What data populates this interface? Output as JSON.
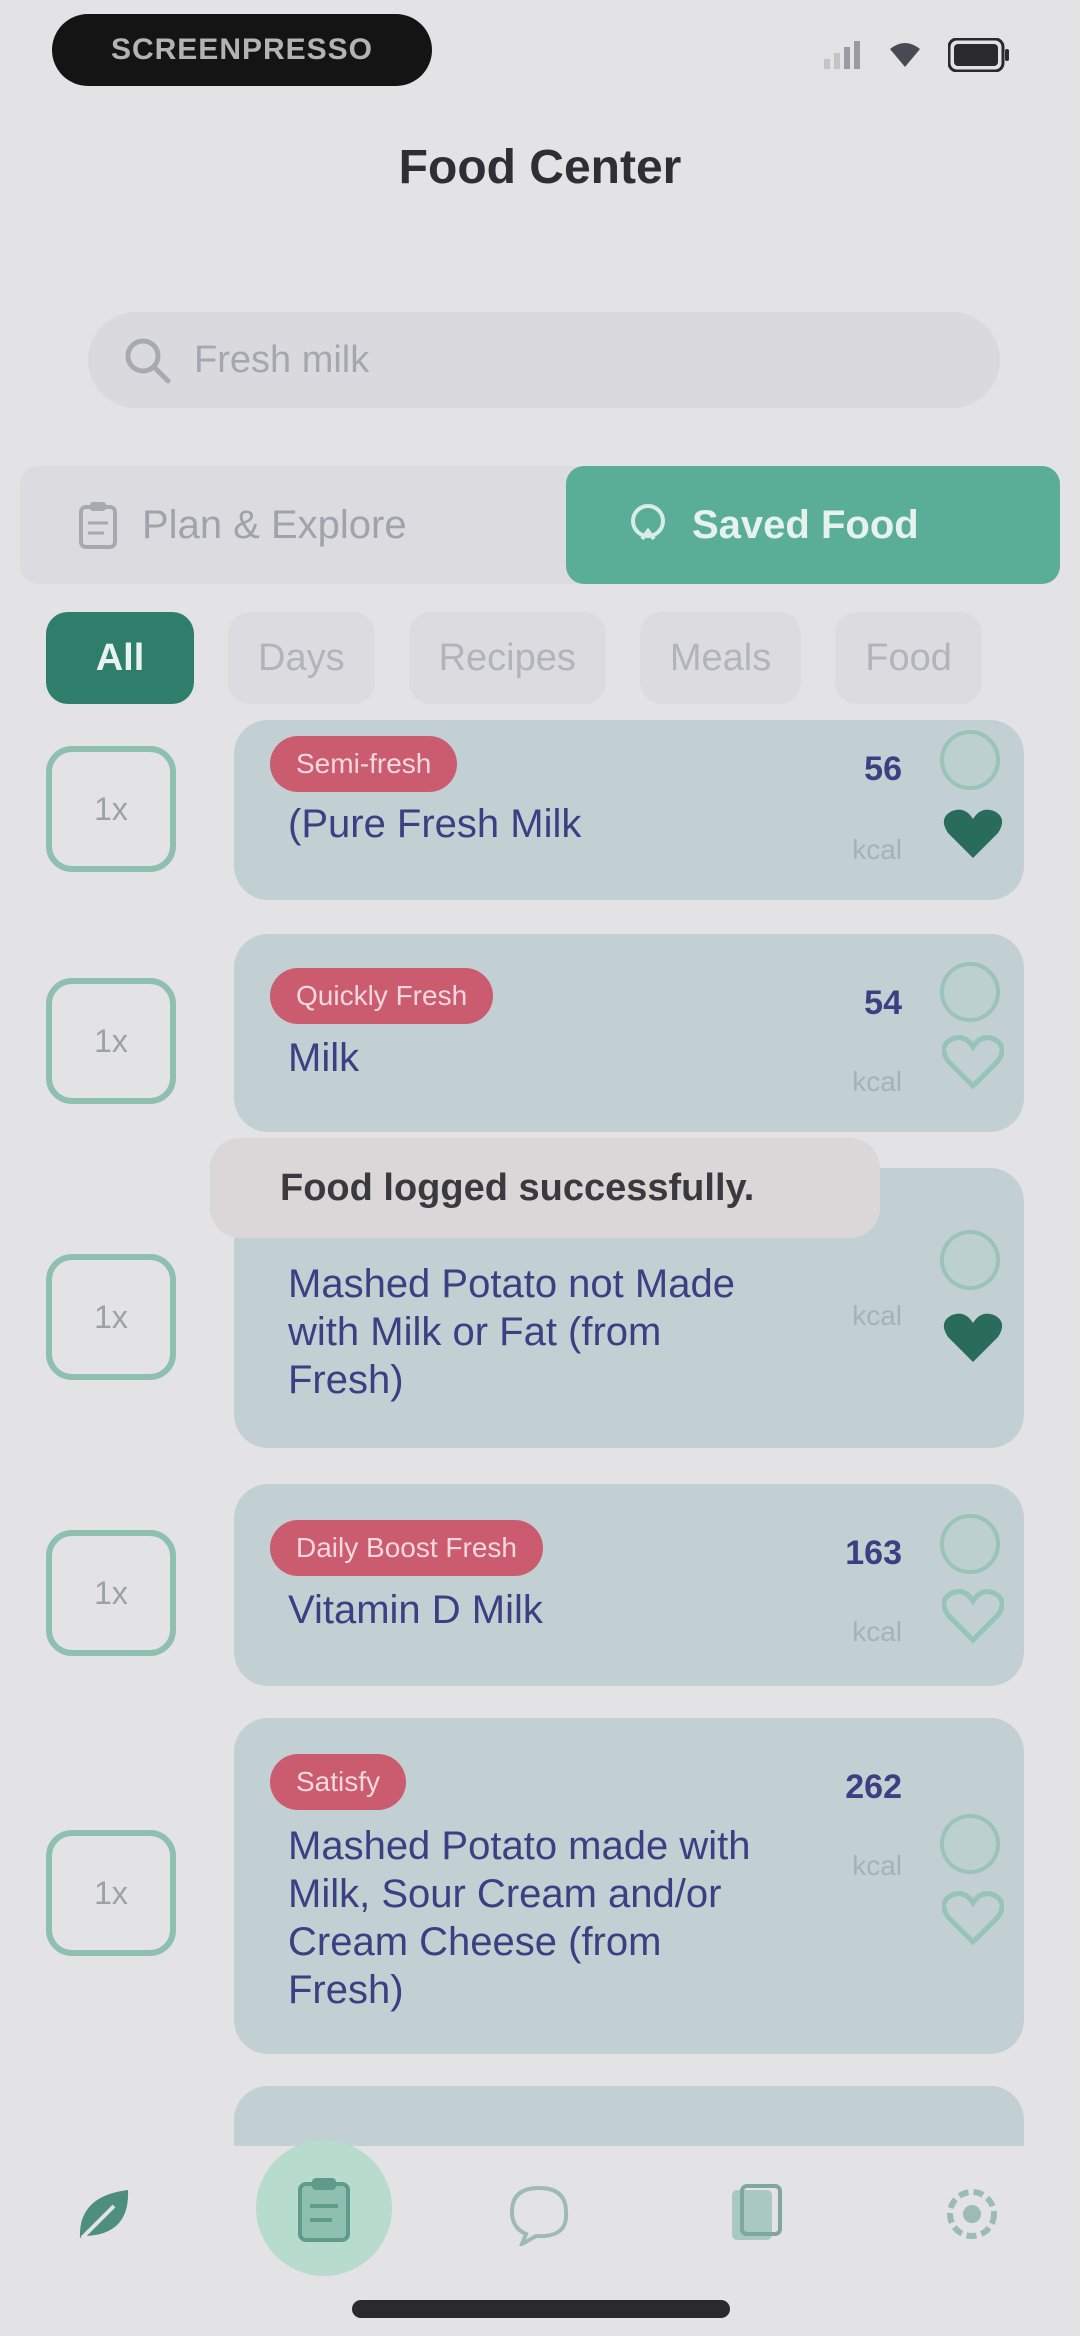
{
  "status_bar": {
    "pill_text": "SCREENPRESSO"
  },
  "header": {
    "title": "Food Center"
  },
  "search": {
    "placeholder": "Fresh milk"
  },
  "segments": [
    {
      "label": "Plan & Explore",
      "icon": "clipboard-icon",
      "active": false
    },
    {
      "label": "Saved Food",
      "icon": "bookmark-icon",
      "active": true
    }
  ],
  "filters": [
    "All",
    "Days",
    "Recipes",
    "Meals",
    "Food"
  ],
  "foods": [
    {
      "badge": "Semi-fresh",
      "name": "(Pure Fresh Milk",
      "cal": "56",
      "unit": "kcal",
      "favorite": true
    },
    {
      "badge": "Quickly Fresh",
      "name": "Milk",
      "cal": "54",
      "unit": "kcal",
      "favorite": false
    },
    {
      "badge": "",
      "name": "Mashed Potato not Made with Milk or Fat (from Fresh)",
      "cal": "",
      "unit": "kcal",
      "favorite": true
    },
    {
      "badge": "Daily Boost Fresh",
      "name": "Vitamin D Milk",
      "cal": "163",
      "unit": "kcal",
      "favorite": false
    },
    {
      "badge": "Satisfy",
      "name": "Mashed Potato made with Milk, Sour Cream and/or Cream Cheese (from Fresh)",
      "cal": "262",
      "unit": "kcal",
      "favorite": false
    }
  ],
  "toast": {
    "message": "Food logged successfully."
  },
  "row_box_label": "1x",
  "colors": {
    "primary": "#2f7e6b",
    "accent": "#5aae98",
    "badge": "#cb5b6e",
    "card": "#c2d0d3"
  },
  "nav": [
    "leaf-icon",
    "clipboard-icon",
    "chat-icon",
    "book-icon",
    "settings-icon"
  ]
}
